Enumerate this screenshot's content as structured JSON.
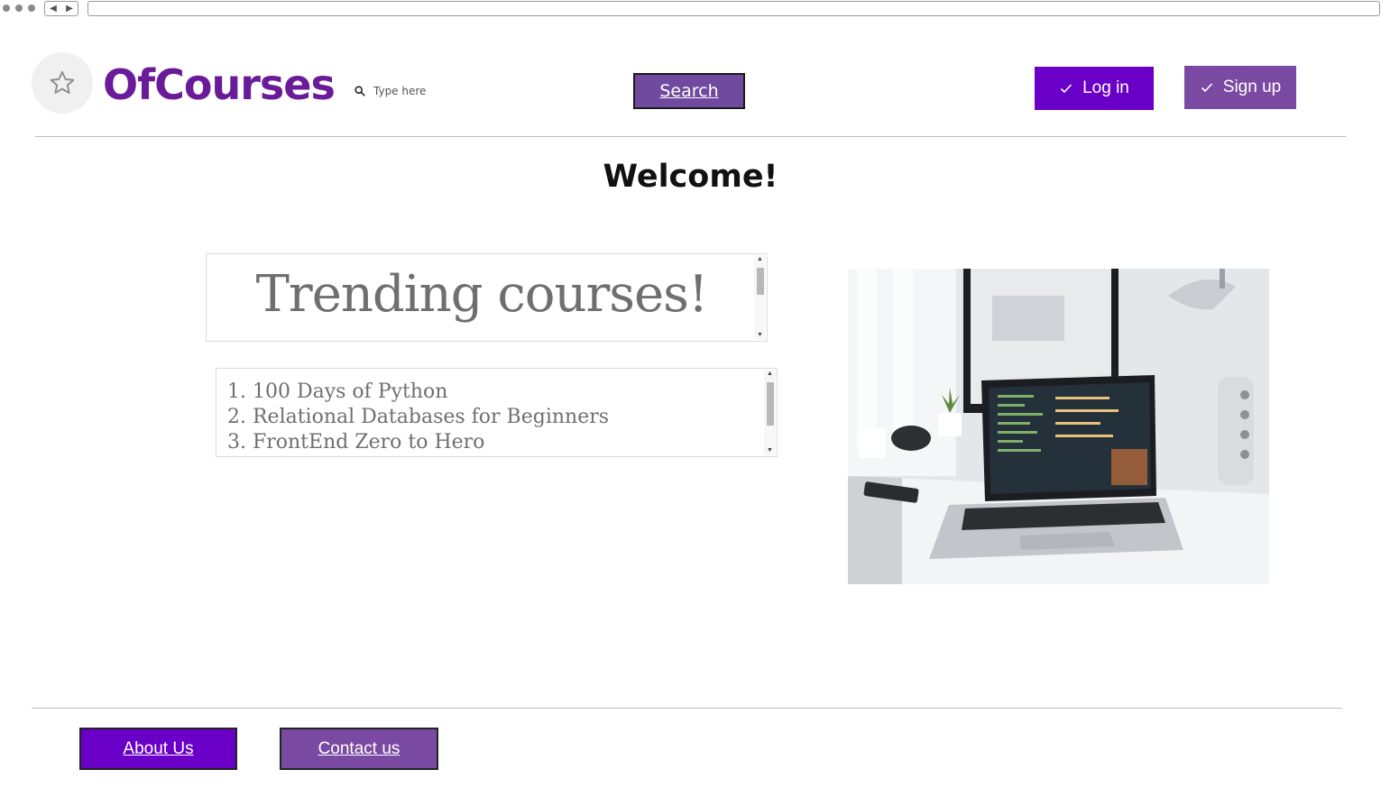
{
  "header": {
    "brand": "OfCourses",
    "logo_icon": "star-icon",
    "search": {
      "placeholder": "Type here",
      "value": "",
      "icon": "search-icon",
      "button_label": "Search"
    },
    "login_label": "Log in",
    "signup_label": "Sign up",
    "button_icon": "check-icon"
  },
  "main": {
    "welcome": "Welcome!",
    "trending_title": "Trending courses!",
    "courses": [
      "1. 100 Days of Python",
      "2. Relational Databases for Beginners",
      "3. FrontEnd Zero to Hero"
    ],
    "image_subject": "laptop on desk"
  },
  "footer": {
    "about_label": "About Us",
    "contact_label": "Contact us"
  },
  "colors": {
    "brand": "#6a1b9a",
    "primary": "#6a00c8",
    "secondary": "#7a4aa3",
    "search_button": "#6f4a9e"
  }
}
